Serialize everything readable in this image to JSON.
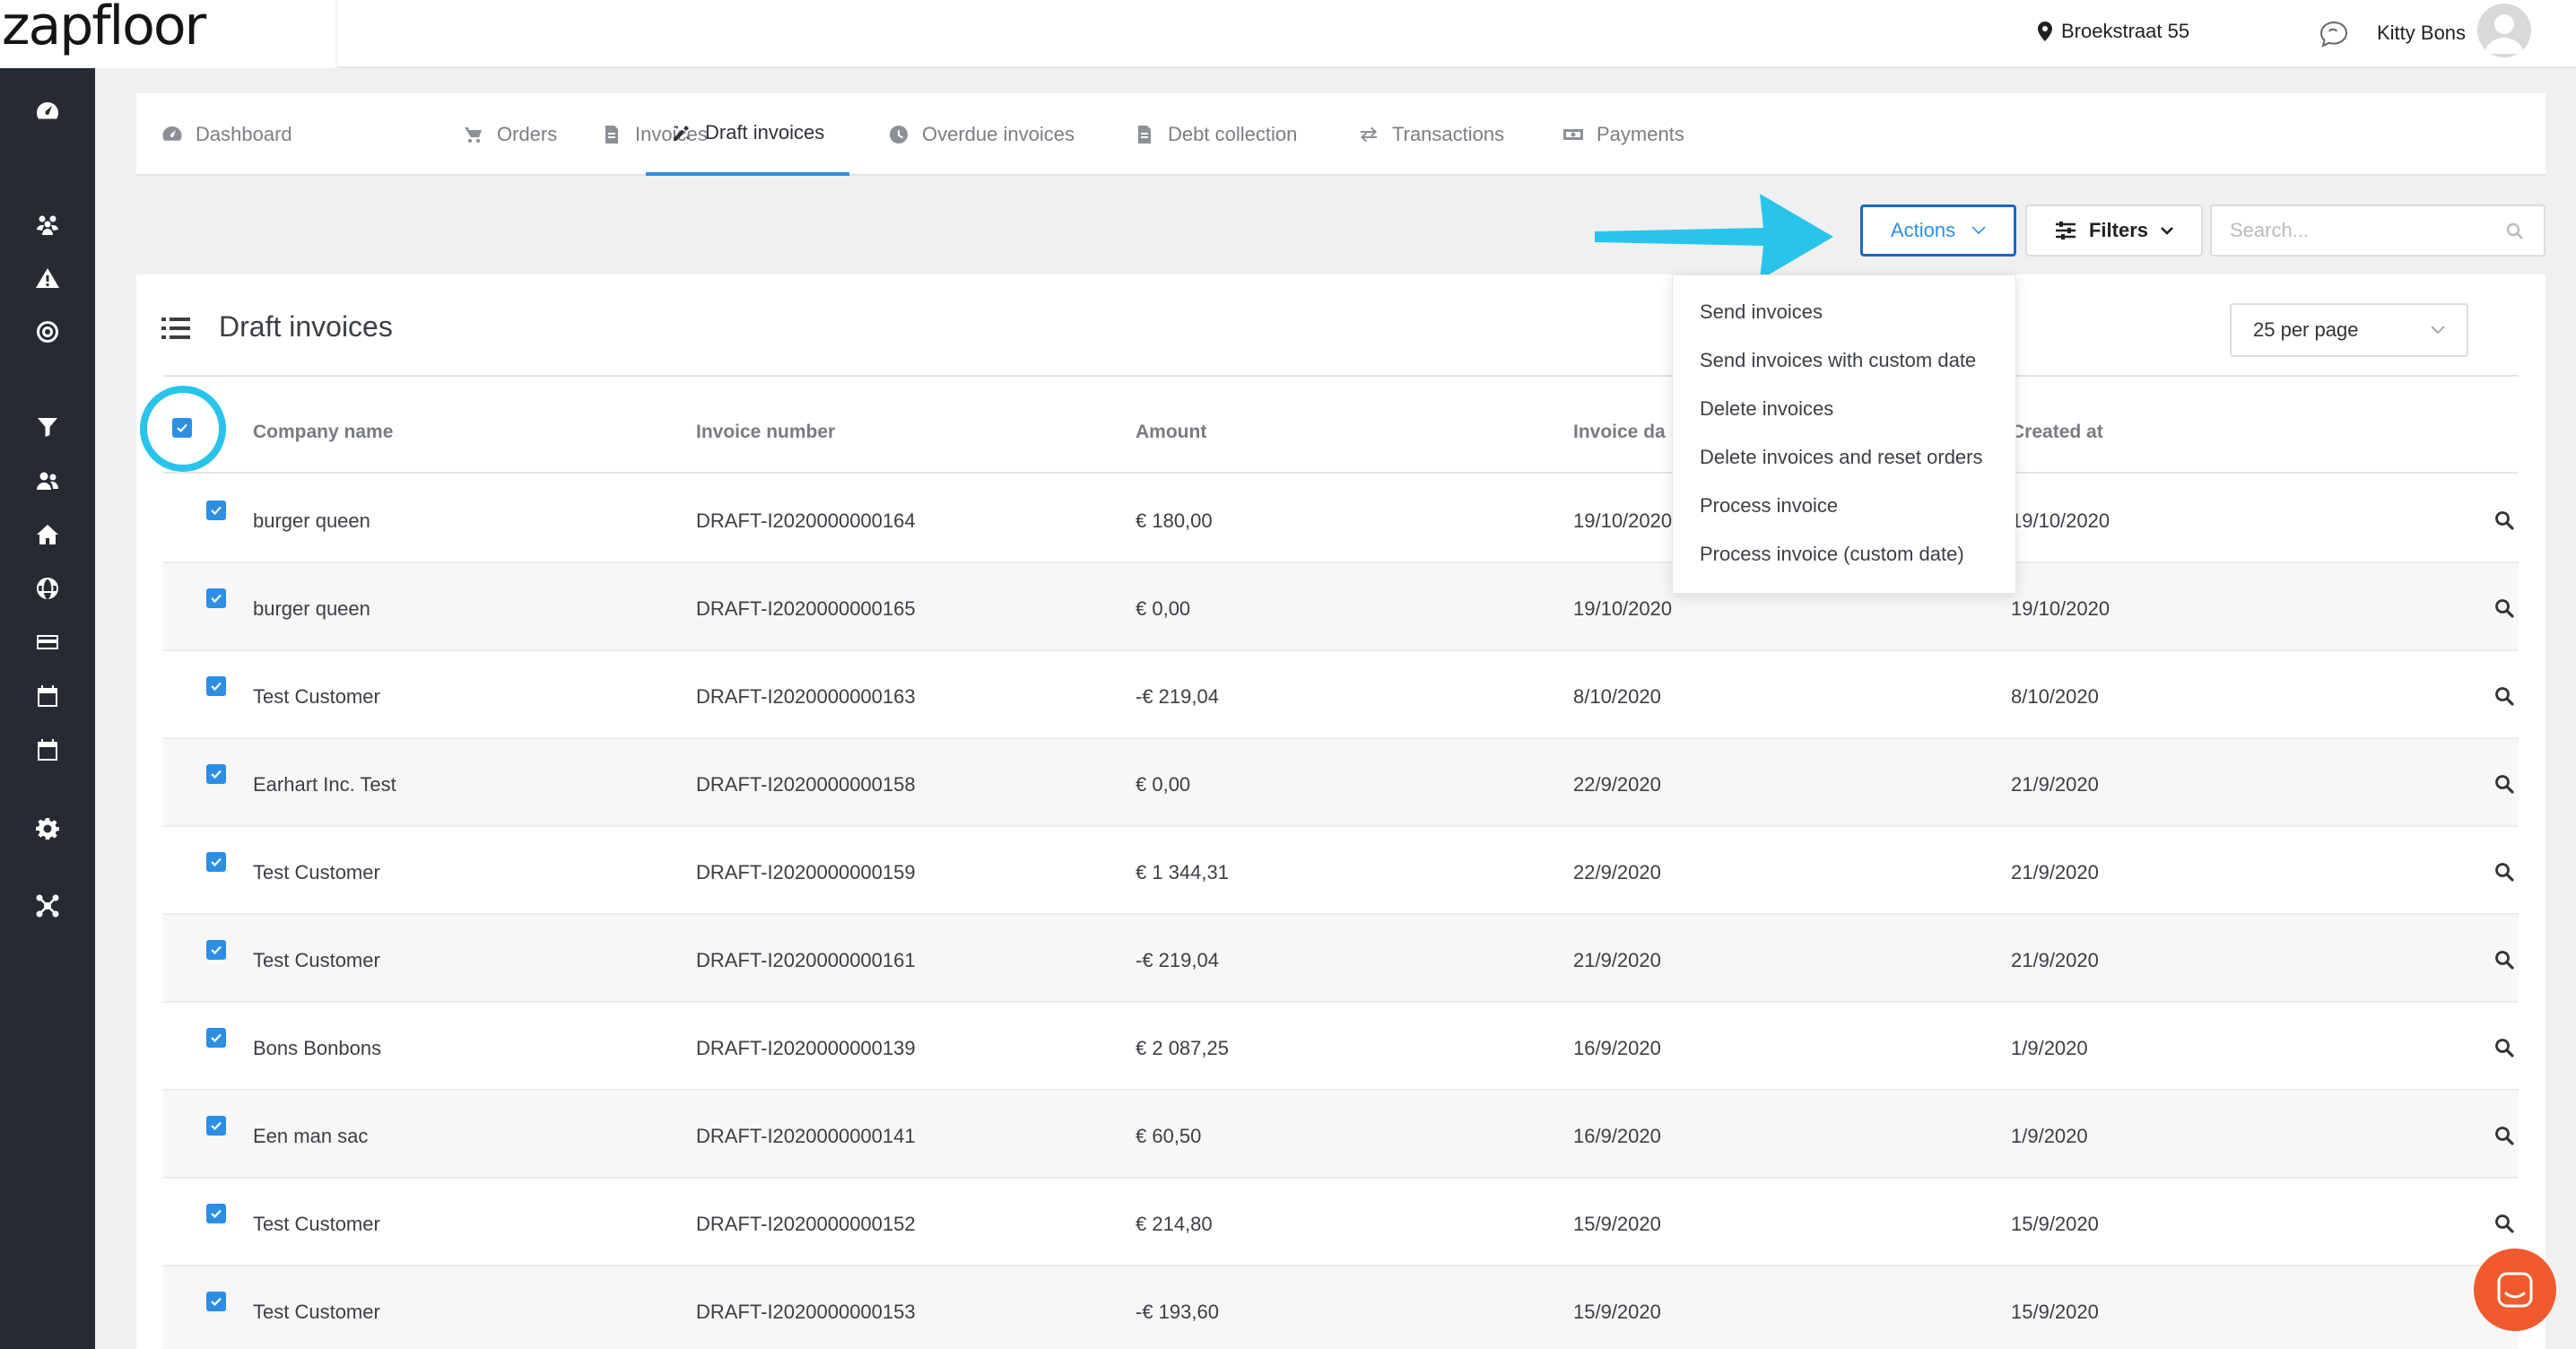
{
  "app": {
    "logo": "zapfloor",
    "location": "Broekstraat 55",
    "user_name": "Kitty Bons"
  },
  "sidebar": {
    "icons": [
      "dashboard-icon",
      "users-group-icon",
      "warning-icon",
      "target-icon",
      "filter-icon",
      "people-icon",
      "home-icon",
      "globe-icon",
      "credit-card-icon",
      "calendar-icon",
      "calendar-alt-icon",
      "settings-icon",
      "integrations-icon"
    ]
  },
  "tabs": [
    {
      "label": "Dashboard",
      "icon": "dashboard-icon"
    },
    {
      "label": "Orders",
      "icon": "orders-icon"
    },
    {
      "label": "Invoices",
      "icon": "invoice-icon"
    },
    {
      "label": "Draft invoices",
      "icon": "draft-icon",
      "active": true
    },
    {
      "label": "Overdue invoices",
      "icon": "clock-icon"
    },
    {
      "label": "Debt collection",
      "icon": "document-icon"
    },
    {
      "label": "Transactions",
      "icon": "transfer-icon"
    },
    {
      "label": "Payments",
      "icon": "cash-icon"
    }
  ],
  "toolbar": {
    "actions_label": "Actions",
    "filters_label": "Filters",
    "search_placeholder": "Search..."
  },
  "actions_menu": [
    "Send invoices",
    "Send invoices with custom date",
    "Delete invoices",
    "Delete invoices and reset orders",
    "Process invoice",
    "Process invoice (custom date)"
  ],
  "card": {
    "title": "Draft invoices",
    "per_page": "25 per page"
  },
  "table": {
    "columns": [
      "Company name",
      "Invoice number",
      "Amount",
      "Invoice da",
      "Created at"
    ],
    "rows": [
      {
        "company": "burger queen",
        "number": "DRAFT-I2020000000164",
        "amount": "€ 180,00",
        "invoice_date": "19/10/2020",
        "created_at": "19/10/2020"
      },
      {
        "company": "burger queen",
        "number": "DRAFT-I2020000000165",
        "amount": "€ 0,00",
        "invoice_date": "19/10/2020",
        "created_at": "19/10/2020"
      },
      {
        "company": "Test Customer",
        "number": "DRAFT-I2020000000163",
        "amount": "-€ 219,04",
        "invoice_date": "8/10/2020",
        "created_at": "8/10/2020"
      },
      {
        "company": "Earhart Inc. Test",
        "number": "DRAFT-I2020000000158",
        "amount": "€ 0,00",
        "invoice_date": "22/9/2020",
        "created_at": "21/9/2020"
      },
      {
        "company": "Test Customer",
        "number": "DRAFT-I2020000000159",
        "amount": "€ 1 344,31",
        "invoice_date": "22/9/2020",
        "created_at": "21/9/2020"
      },
      {
        "company": "Test Customer",
        "number": "DRAFT-I2020000000161",
        "amount": "-€ 219,04",
        "invoice_date": "21/9/2020",
        "created_at": "21/9/2020"
      },
      {
        "company": "Bons Bonbons",
        "number": "DRAFT-I2020000000139",
        "amount": "€ 2 087,25",
        "invoice_date": "16/9/2020",
        "created_at": "1/9/2020"
      },
      {
        "company": "Een man sac",
        "number": "DRAFT-I2020000000141",
        "amount": "€ 60,50",
        "invoice_date": "16/9/2020",
        "created_at": "1/9/2020"
      },
      {
        "company": "Test Customer",
        "number": "DRAFT-I2020000000152",
        "amount": "€ 214,80",
        "invoice_date": "15/9/2020",
        "created_at": "15/9/2020"
      },
      {
        "company": "Test Customer",
        "number": "DRAFT-I2020000000153",
        "amount": "-€ 193,60",
        "invoice_date": "15/9/2020",
        "created_at": "15/9/2020"
      }
    ]
  },
  "colors": {
    "accent": "#2d8fe3",
    "sidebar": "#262b33",
    "annotation": "#29c4ec",
    "support": "#f05a2c"
  }
}
